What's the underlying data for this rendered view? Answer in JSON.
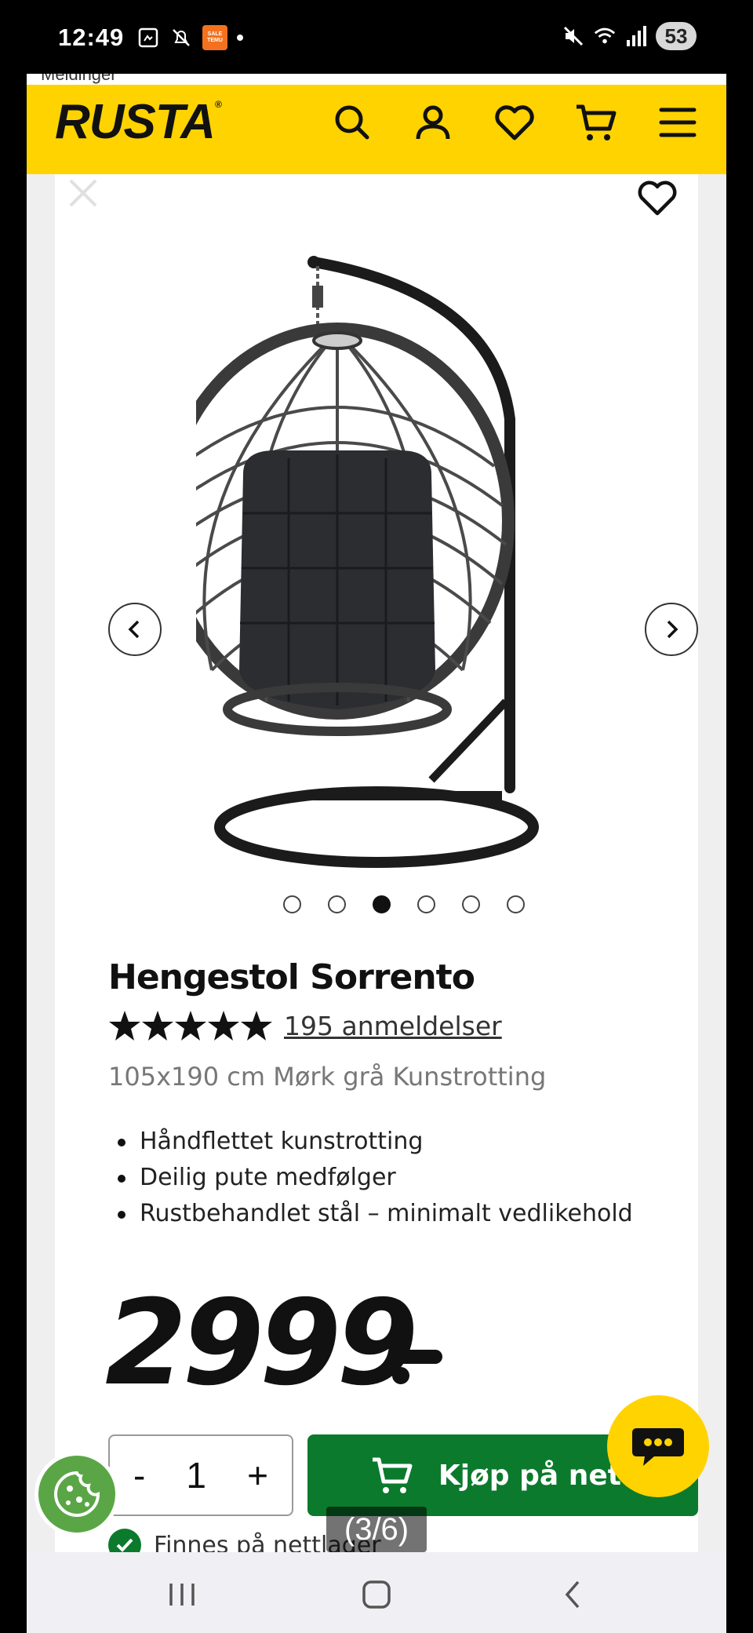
{
  "status_bar": {
    "time": "12:49",
    "temu_label": "SALE TEMU",
    "battery": "53"
  },
  "header": {
    "back_label": "Meldinger",
    "logo": "RUSTA",
    "logo_mark": "®",
    "icons": [
      "search-icon",
      "account-icon",
      "heart-icon",
      "cart-icon",
      "menu-icon"
    ],
    "brand_color": "#ffd300"
  },
  "product": {
    "title": "Hengestol Sorrento",
    "rating_stars": 5,
    "reviews_label": "195 anmeldelser",
    "variant": "105x190 cm Mørk grå Kunstrotting",
    "features": [
      "Håndflettet kunstrotting",
      "Deilig pute medfølger",
      "Rustbehandlet stål – minimalt vedlikehold"
    ],
    "price": "2999",
    "image_counter": "(3/6)",
    "carousel": {
      "total": 6,
      "active": 3
    }
  },
  "purchase": {
    "quantity": "1",
    "minus": "-",
    "plus": "+",
    "buy_label": "Kjøp på nett",
    "buy_color": "#0b7a2c"
  },
  "stock": {
    "text": "Finnes på nettlager"
  }
}
